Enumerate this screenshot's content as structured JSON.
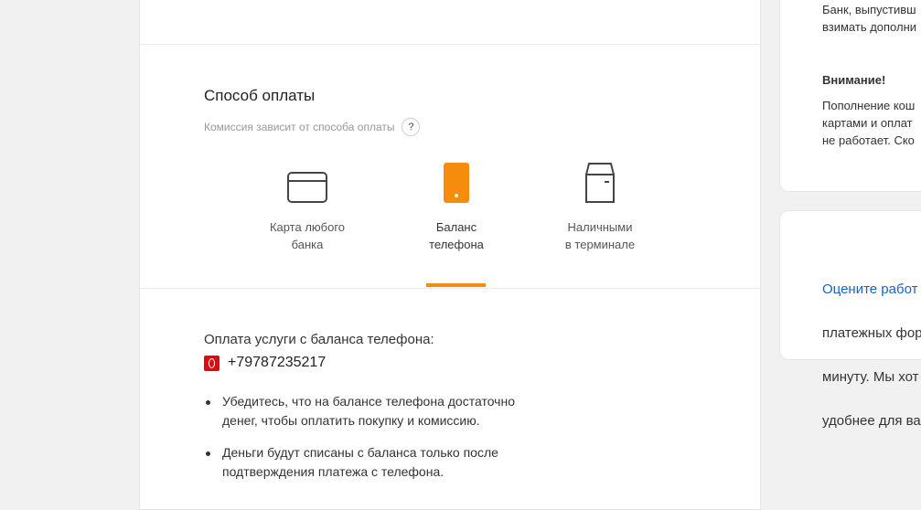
{
  "payment": {
    "title": "Способ оплаты",
    "hint": "Комиссия зависит от способа оплаты",
    "hint_icon": "?",
    "methods": [
      {
        "label_line1": "Карта любого",
        "label_line2": "банка",
        "icon": "card-icon"
      },
      {
        "label_line1": "Баланс",
        "label_line2": "телефона",
        "icon": "phone-icon",
        "active": true
      },
      {
        "label_line1": "Наличными",
        "label_line2": "в терминале",
        "icon": "terminal-icon"
      }
    ],
    "accent_color": "#f68c0c"
  },
  "phone_payment": {
    "intro": "Оплата услуги с баланса телефона:",
    "phone": "+79787235217",
    "bullets": [
      {
        "line1": "Убедитесь, что на балансе телефона достаточно",
        "line2": "денег, чтобы оплатить покупку и комиссию."
      },
      {
        "line1": "Деньги будут списаны с баланса только после",
        "line2": "подтверждения платежа с телефона."
      }
    ]
  },
  "sidebar": {
    "info_line1": "Банк, выпустивш",
    "info_line2": "взимать дополни",
    "attention_title": "Внимание!",
    "attention_line1": "Пополнение кош",
    "attention_line2": "картами и оплат",
    "attention_line3": "не работает. Ско",
    "rate_link": "Оцените работ",
    "rate_line1": "платежных фор",
    "rate_line2": "минуту. Мы хот",
    "rate_line3": "удобнее для ва"
  }
}
